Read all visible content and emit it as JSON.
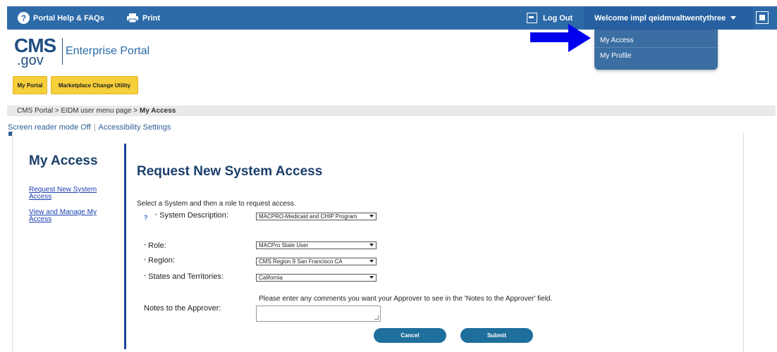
{
  "topbar": {
    "help_label": "Portal Help & FAQs",
    "print_label": "Print",
    "logout_label": "Log Out",
    "welcome_label": "Welcome impl qeidmvaltwentythree"
  },
  "user_menu": {
    "items": [
      "My Access",
      "My Profile"
    ]
  },
  "logo": {
    "cms": "CMS",
    "gov": ".gov",
    "portal": "Enterprise Portal"
  },
  "nav_tabs": [
    "My Portal",
    "Marketplace Change Utility"
  ],
  "breadcrumb": {
    "items": [
      "CMS Portal",
      "EIDM user menu page",
      "My Access"
    ],
    "separator": " > "
  },
  "accessibility": {
    "screen_reader": "Screen reader mode Off",
    "separator": "|",
    "settings": "Accessibility Settings"
  },
  "sidebar": {
    "title": "My Access",
    "links": [
      "Request New System Access",
      "View and Manage My Access"
    ]
  },
  "form": {
    "title": "Request New System Access",
    "intro": "Select a System and then a role to request access.",
    "help_glyph": "?",
    "required_mark": "*",
    "fields": [
      {
        "label": "System Description:",
        "value": "MACPRO-Medicaid and CHIP Program"
      },
      {
        "label": "Role:",
        "value": "MACPro State User"
      },
      {
        "label": "Region:",
        "value": "CMS Region 9 San Francisco CA"
      },
      {
        "label": "States and Territories:",
        "value": "California"
      }
    ],
    "notes_hint": "Please enter any comments you want your Approver to see in the 'Notes to the Approver' field.",
    "notes_label": "Notes to the Approver:",
    "notes_value": "",
    "cancel_label": "Cancel",
    "submit_label": "Submit"
  },
  "colors": {
    "topbar": "#2d6aa8",
    "dropdown": "#3b6ea3",
    "tab_yellow": "#f7cf3a",
    "heading": "#1b3f6b",
    "link": "#1a3fb0",
    "button": "#1f6f9c",
    "arrow": "#0000ee"
  }
}
